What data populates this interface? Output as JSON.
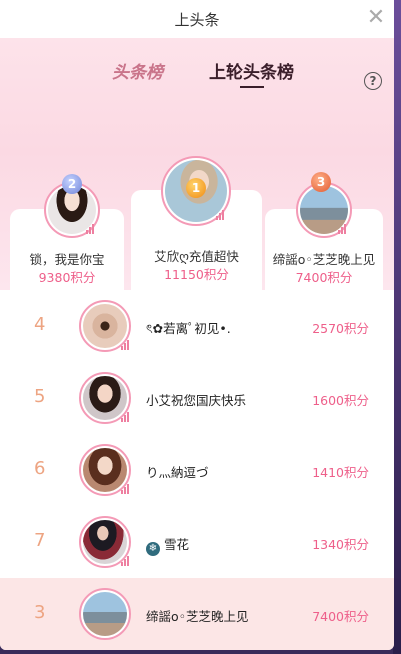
{
  "window": {
    "title": "上头条"
  },
  "tabs": [
    {
      "label": "头条榜"
    },
    {
      "label": "上轮头条榜"
    }
  ],
  "top3": [
    {
      "rank": "2",
      "name": "锁，我是你宝",
      "score": "9380积分"
    },
    {
      "rank": "1",
      "name": "艾欣ღ充值超快",
      "score": "11150积分"
    },
    {
      "rank": "3",
      "name": "缔謡o◦芝芝晚上见",
      "score": "7400积分"
    }
  ],
  "list": [
    {
      "rank": "4",
      "name": "ৎ✿若离ﾟ初见•.",
      "score": "2570积分"
    },
    {
      "rank": "5",
      "name": "小艾祝您国庆快乐",
      "score": "1600积分"
    },
    {
      "rank": "6",
      "name": "り灬納逗づ",
      "score": "1410积分"
    },
    {
      "rank": "7",
      "name": "雪花",
      "score": "1340积分"
    }
  ],
  "my_row": {
    "rank": "3",
    "name": "缔謡o◦芝芝晚上见",
    "score": "7400积分"
  },
  "colors": {
    "accent": "#ee5f8a",
    "rank_num": "#eda482",
    "hero_bg": "#fbd9e3",
    "my_row_bg": "#fce6e6"
  },
  "icons": {
    "close": "close-icon",
    "help": "help-icon",
    "level": "level-bars-icon",
    "snowflake": "snowflake-icon"
  }
}
